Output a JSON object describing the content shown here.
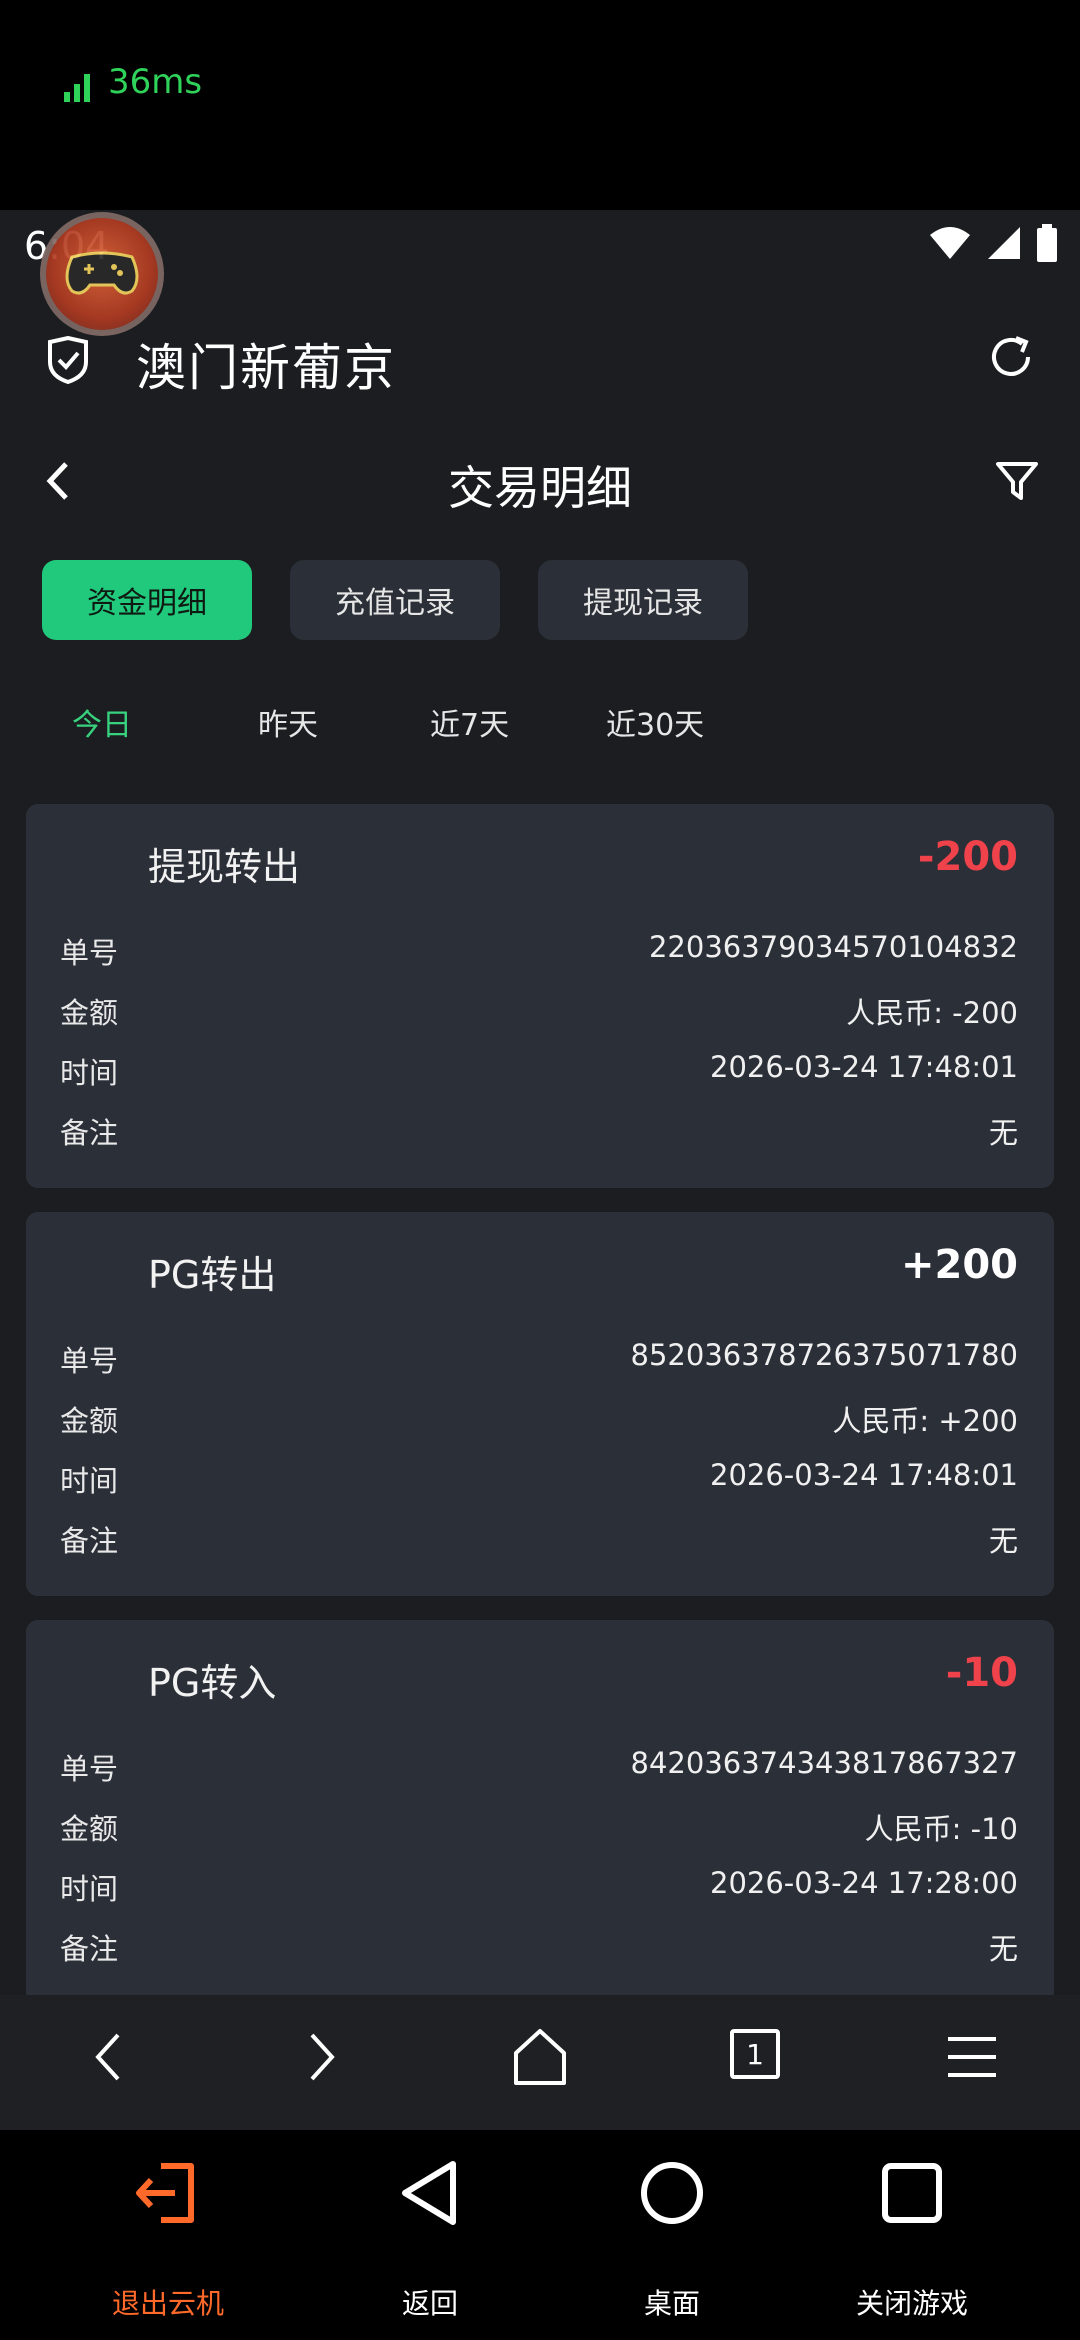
{
  "overlay": {
    "latency": "36ms"
  },
  "status_bar": {
    "time": "6:04"
  },
  "app": {
    "title": "澳门新葡京"
  },
  "page": {
    "title": "交易明细"
  },
  "tabs": [
    "资金明细",
    "充值记录",
    "提现记录"
  ],
  "ranges": [
    "今日",
    "昨天",
    "近7天",
    "近30天"
  ],
  "field_labels": {
    "order": "单号",
    "amount": "金额",
    "time": "时间",
    "note": "备注"
  },
  "transactions": [
    {
      "title": "提现转出",
      "amount": "-200",
      "order": "22036379034570104832",
      "amount_detail": "人民币: -200",
      "time": "2026-03-24 17:48:01",
      "note": "无"
    },
    {
      "title": "PG转出",
      "amount": "+200",
      "order": "852036378726375071780",
      "amount_detail": "人民币: +200",
      "time": "2026-03-24 17:48:01",
      "note": "无"
    },
    {
      "title": "PG转入",
      "amount": "-10",
      "order": "842036374343817867327",
      "amount_detail": "人民币: -10",
      "time": "2026-03-24 17:28:00",
      "note": "无"
    }
  ],
  "browser_bar": {
    "tab_count": "1"
  },
  "system_nav": {
    "exit": "退出云机",
    "back": "返回",
    "home": "桌面",
    "close": "关闭游戏"
  },
  "colors": {
    "accent": "#20c97b",
    "negative": "#f0424b",
    "exit_orange": "#ff6a2a"
  }
}
